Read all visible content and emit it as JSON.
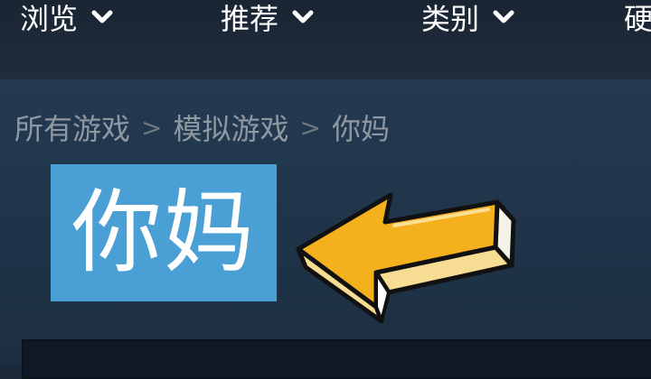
{
  "nav": {
    "items": [
      {
        "label": "浏览",
        "icon": "chevron-down-icon"
      },
      {
        "label": "推荐",
        "icon": "chevron-down-icon"
      },
      {
        "label": "类别",
        "icon": "chevron-down-icon"
      },
      {
        "label": "硬"
      }
    ]
  },
  "breadcrumb": {
    "items": [
      "所有游戏",
      "模拟游戏",
      "你妈"
    ],
    "separator": ">"
  },
  "page": {
    "title": "你妈"
  },
  "colors": {
    "nav_bg": "#1a2533",
    "content_bg": "#233a52",
    "title_highlight": "#4a9fd4",
    "breadcrumb_text": "#8f98a0",
    "arrow_fill": "#f5b01e",
    "arrow_light": "#f7dc93"
  },
  "annotation": {
    "icon": "arrow-left-icon"
  }
}
